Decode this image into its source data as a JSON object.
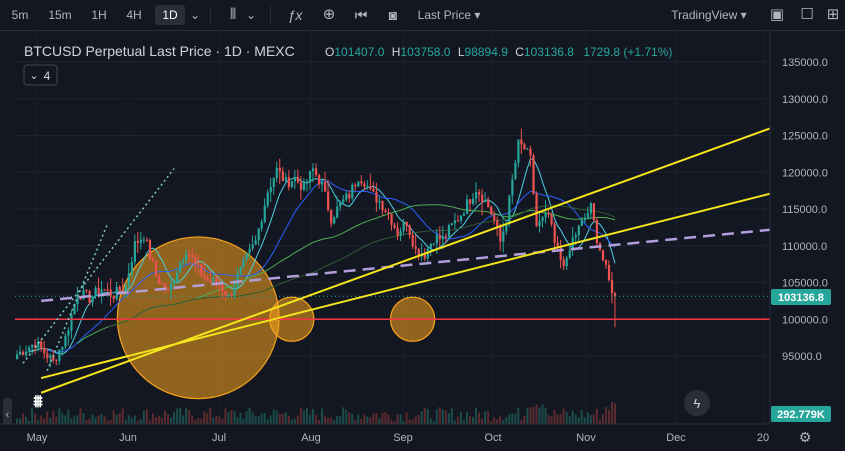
{
  "toolbar": {
    "intervals": [
      "5m",
      "15m",
      "1H",
      "4H",
      "1D"
    ],
    "active_interval": "1D",
    "price_type": "Last Price",
    "brand": "TradingView",
    "icons": [
      "chevron-down-icon",
      "candles-icon",
      "indicators-icon",
      "alerts-icon",
      "replay-icon",
      "camera-icon",
      "layout-icon",
      "settings-icon",
      "snapshot-icon"
    ]
  },
  "legend": {
    "title": "BTCUSD Perpetual Last Price · 1D · MEXC",
    "o_label": "O",
    "o_value": "101407.0",
    "h_label": "H",
    "h_value": "103758.0",
    "l_label": "L",
    "l_value": "98894.9",
    "c_label": "C",
    "c_value": "103136.8",
    "change": "1729.8 (+1.71%)",
    "indicators_count": "4"
  },
  "axis": {
    "price_labels": [
      "135000.0",
      "130000.0",
      "125000.0",
      "120000.0",
      "115000.0",
      "110000.0",
      "105000.0",
      "100000.0",
      "95000.0"
    ],
    "current_price": "103136.8",
    "volume_label": "292.779K",
    "time_labels": [
      "May",
      "Jun",
      "Jul",
      "Aug",
      "Sep",
      "Oct",
      "Nov",
      "Dec",
      "20"
    ]
  },
  "colors": {
    "up": "#26a69a",
    "down": "#ef5350",
    "channel": "#f5e51b",
    "dashed": "#b39ddb",
    "support": "#f23645",
    "circle": "#f7a21b",
    "ma_light": "#4dd0e1",
    "ma_blue": "#2962ff",
    "ma_green": "#4caf50"
  },
  "chart_data": {
    "type": "candlestick",
    "symbol": "BTCUSD Perpetual",
    "interval": "1D",
    "ylim": [
      90500,
      137500
    ],
    "y_ticks": [
      95000,
      100000,
      105000,
      110000,
      115000,
      120000,
      125000,
      130000,
      135000
    ],
    "x_ticks": [
      "May",
      "Jun",
      "Jul",
      "Aug",
      "Sep",
      "Oct",
      "Nov",
      "Dec",
      "20"
    ],
    "last": {
      "open": 101407.0,
      "high": 103758.0,
      "low": 98894.9,
      "close": 103136.8,
      "change": 1729.8,
      "change_pct": 1.71
    },
    "close_path": [
      [
        0,
        95200
      ],
      [
        6,
        96800
      ],
      [
        12,
        94200
      ],
      [
        16,
        97500
      ],
      [
        20,
        103600
      ],
      [
        24,
        102900
      ],
      [
        28,
        104200
      ],
      [
        32,
        103300
      ],
      [
        36,
        104600
      ],
      [
        39,
        110200
      ],
      [
        42,
        111500
      ],
      [
        46,
        105900
      ],
      [
        50,
        103500
      ],
      [
        53,
        106800
      ],
      [
        56,
        109600
      ],
      [
        60,
        106700
      ],
      [
        63,
        105300
      ],
      [
        67,
        104800
      ],
      [
        70,
        103000
      ],
      [
        73,
        105700
      ],
      [
        76,
        108300
      ],
      [
        79,
        110500
      ],
      [
        83,
        117500
      ],
      [
        86,
        120300
      ],
      [
        89,
        118600
      ],
      [
        92,
        119200
      ],
      [
        95,
        117800
      ],
      [
        98,
        120400
      ],
      [
        101,
        118200
      ],
      [
        104,
        113800
      ],
      [
        107,
        115600
      ],
      [
        110,
        116900
      ],
      [
        113,
        119500
      ],
      [
        115,
        118800
      ],
      [
        117,
        117200
      ],
      [
        120,
        116100
      ],
      [
        123,
        114400
      ],
      [
        126,
        111800
      ],
      [
        129,
        113300
      ],
      [
        132,
        109400
      ],
      [
        135,
        108900
      ],
      [
        138,
        111100
      ],
      [
        141,
        110900
      ],
      [
        144,
        112700
      ],
      [
        147,
        114300
      ],
      [
        150,
        116400
      ],
      [
        152,
        117800
      ],
      [
        154,
        116700
      ],
      [
        156,
        115400
      ],
      [
        158,
        113400
      ],
      [
        160,
        110500
      ],
      [
        162,
        113600
      ],
      [
        164,
        118800
      ],
      [
        166,
        123800
      ],
      [
        168,
        123200
      ],
      [
        170,
        121700
      ],
      [
        172,
        112700
      ],
      [
        174,
        113400
      ],
      [
        176,
        114200
      ],
      [
        178,
        110200
      ],
      [
        180,
        108200
      ],
      [
        182,
        107600
      ],
      [
        184,
        110900
      ],
      [
        186,
        112300
      ],
      [
        188,
        113800
      ],
      [
        190,
        115200
      ],
      [
        192,
        111100
      ],
      [
        194,
        108100
      ],
      [
        196,
        105100
      ],
      [
        198,
        103100
      ]
    ],
    "overlays": {
      "channel_upper": [
        [
          90000,
          8
        ],
        [
          135000,
          310
        ]
      ],
      "channel_lower": [
        [
          92000,
          8
        ],
        [
          100000,
          85
        ]
      ],
      "dashed_line": [
        [
          102500,
          8
        ],
        [
          113800,
          290
        ]
      ],
      "support": 100000,
      "circles": [
        [
          100200,
          60,
          22000
        ],
        [
          100000,
          91,
          6000
        ],
        [
          100000,
          131,
          6000
        ]
      ]
    }
  }
}
